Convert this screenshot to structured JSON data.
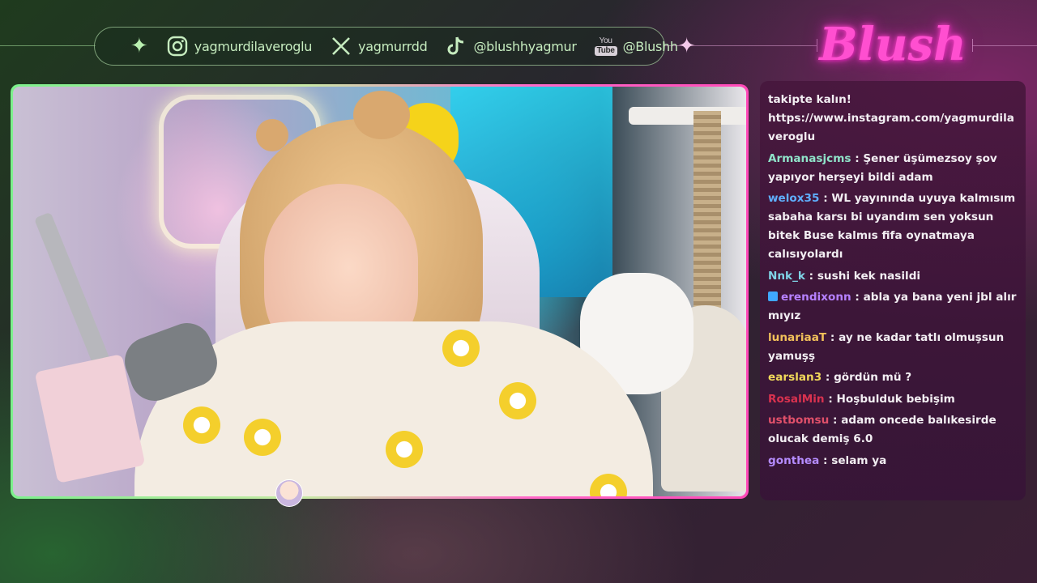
{
  "banner": {
    "socials": [
      {
        "platform": "instagram",
        "icon": "instagram-icon",
        "handle": "yagmurdilaveroglu"
      },
      {
        "platform": "x",
        "icon": "x-twitter-icon",
        "handle": "yagmurrdd"
      },
      {
        "platform": "tiktok",
        "icon": "tiktok-icon",
        "handle": "@blushhyagmur"
      },
      {
        "platform": "youtube",
        "icon": "youtube-icon",
        "icon_text_top": "You",
        "icon_text_bottom": "Tube",
        "handle": "@Blushh"
      }
    ],
    "logo_text": "Blush",
    "accent_green": "#c6ecbf",
    "accent_pink": "#ff4fd0"
  },
  "chat": {
    "messages": [
      {
        "user": "",
        "user_color": "#e0506a",
        "text": "takipte kalın! https://www.instagram.com/yagmurdilaveroglu",
        "cut": true
      },
      {
        "user": "Armanasjcms",
        "user_color": "#8fe3c9",
        "text": "Şener üşümezsoy şov yapıyor herşeyi bildi adam"
      },
      {
        "user": "welox35",
        "user_color": "#5fb0ff",
        "text": "WL yayınında uyuya kalmısım sabaha karsı bi uyandım sen yoksun bitek Buse kalmıs fifa oynatmaya calısıyolardı"
      },
      {
        "user": "Nnk_k",
        "user_color": "#7fd3e6",
        "text": "sushi kek nasildi"
      },
      {
        "user": "erendixonn",
        "user_color": "#b681ff",
        "text": "abla ya bana yeni jbl alır mıyız",
        "badge": true
      },
      {
        "user": "lunariaaT",
        "user_color": "#f2c15a",
        "text": "ay ne kadar tatlı olmuşsun yamuşş"
      },
      {
        "user": "earslan3",
        "user_color": "#f0d85a",
        "text": "gördün mü ?"
      },
      {
        "user": "RosalMin",
        "user_color": "#d9324f",
        "text": "Hoşbulduk bebişim"
      },
      {
        "user": "ustbomsu",
        "user_color": "#e0506a",
        "text": "adam oncede balıkesirde olucak demiş 6.0"
      },
      {
        "user": "gonthea",
        "user_color": "#b58cff",
        "text": "selam ya"
      }
    ]
  }
}
